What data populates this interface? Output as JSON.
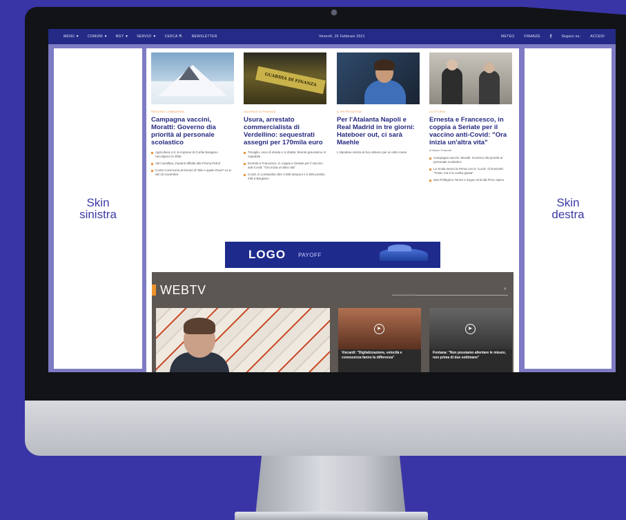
{
  "topnav": {
    "menu": [
      "MENU ▼",
      "COMUNI ▼",
      "BGY ▼",
      "SERVIZI ▼",
      "CERCA 🔍",
      "NEWSLETTER"
    ],
    "date": "Venerdì, 26 Febbraio 2021",
    "right": [
      "METEO",
      "FINANZE",
      "Seguici su:",
      "ACCEDI"
    ]
  },
  "skins": {
    "left": "Skin\nsinistra",
    "right": "Skin\ndestra"
  },
  "articles": [
    {
      "category": "REGIONE LOMBARDIA",
      "title": "Campagna vaccini, Moratti: Governo dia priorità al personale scolastico",
      "bullets": [
        "Agricoltura 4.0, le imprese di Confai Bergamo raccolgono la sfida",
        "Val Cavallina, impianti affidati alla Prema Petrol",
        "Conte Conti torna al timone di Tale e quale show? La tv del 15 novembre"
      ]
    },
    {
      "category": "GUARDIA DI FINANZA",
      "title": "Usura, arrestato commercialista di Verdellino: sequestrati assegni per 170mila euro",
      "bullets": [
        "Treviglio, esce di strada e si ribalta: ferente gravissimo in ospedale",
        "Ernesta e Francesco, in coppia a Seriate per il vaccino anti-Covid: \"Ora inizia un'altra vita\"",
        "Covid, in Lombardia oltre 4.000 tamponi e 2.500 positivi, 238 a Bergamo"
      ]
    },
    {
      "category": "IL RETROSCENA",
      "title": "Per l'Atalanta Napoli e Real Madrid in tre giorni: Hateboer out, ci sarà Maehle",
      "excerpt": "L'olandese rientra al box almeno per un altro mese"
    },
    {
      "category": "LA STORIA",
      "title": "Ernesta e Francesco, in coppia a Seriate per il vaccino anti-Covid: \"Ora inizia un'altra vita\"",
      "author": "di Mauro Frascotti",
      "bullets": [
        "Campagna vaccini, Moratti: Governo dia priorità al personale scolastico",
        "La Scala senza la Prima con la \"Lucia\" di Donizetti: \"Triste, ma è la scelta giusta\"",
        "San Pellegrino Terme e Zogno vinti dal Pizzo Spino"
      ]
    }
  ],
  "photos": {
    "finance_sign": "GUARDIA DI FINANZA"
  },
  "banner": {
    "logo": "LOGO",
    "payoff": "PAYOFF"
  },
  "webtv": {
    "title": "WEBTV",
    "search_placeholder": "Cerca tra i video",
    "videos": [
      {
        "caption": "Viscardi: \"Digitalizzazione, velocità e conoscenza fanno la differenza\""
      },
      {
        "caption": "Fontana: \"Non possiamo allentare le misure, non prima di due settimane\""
      }
    ]
  }
}
